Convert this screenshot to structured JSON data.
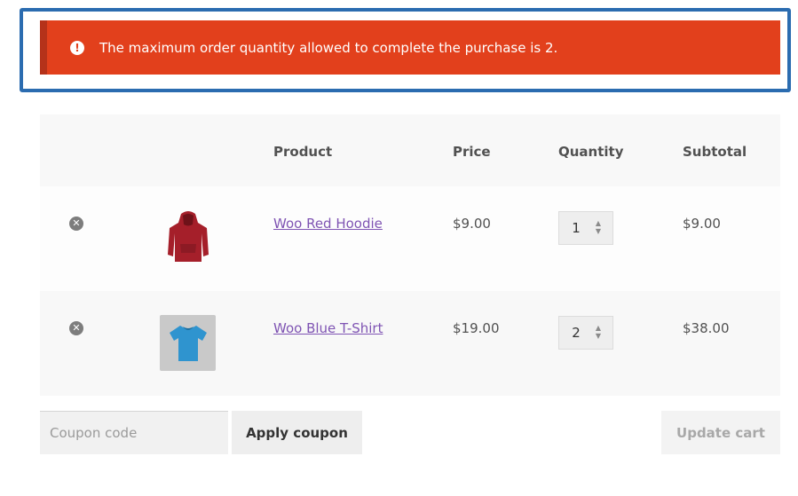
{
  "notice": {
    "icon": "exclamation-circle-icon",
    "message": "The maximum order quantity allowed to complete the purchase is 2.",
    "color": "#e2401c"
  },
  "table": {
    "headers": {
      "product": "Product",
      "price": "Price",
      "quantity": "Quantity",
      "subtotal": "Subtotal"
    }
  },
  "items": [
    {
      "name": "Woo Red Hoodie",
      "price": "$9.00",
      "quantity": "1",
      "subtotal": "$9.00",
      "image": "red-hoodie"
    },
    {
      "name": "Woo Blue T-Shirt",
      "price": "$19.00",
      "quantity": "2",
      "subtotal": "$38.00",
      "image": "blue-tshirt"
    }
  ],
  "coupon": {
    "placeholder": "Coupon code",
    "apply_label": "Apply coupon"
  },
  "update_label": "Update cart"
}
